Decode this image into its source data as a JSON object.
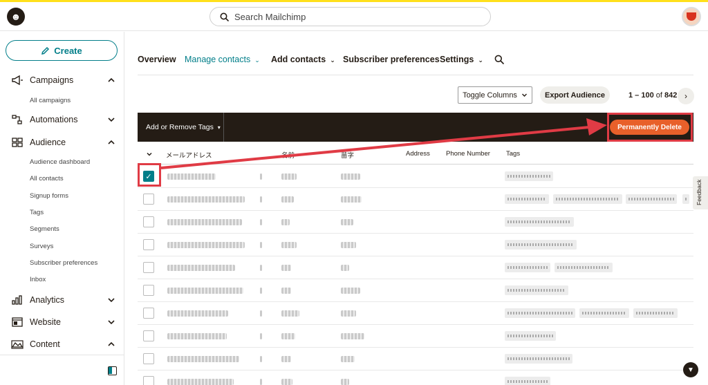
{
  "app": {
    "logo_icon": "mailchimp-logo-icon",
    "accent": "#017e89",
    "brand_yellow": "#ffe01b"
  },
  "search": {
    "placeholder": "Search Mailchimp"
  },
  "sidebar": {
    "create_label": "Create",
    "sections": [
      {
        "label": "Campaigns",
        "icon": "megaphone-icon",
        "expanded": true,
        "items": [
          "All campaigns"
        ]
      },
      {
        "label": "Automations",
        "icon": "automations-icon",
        "expanded": false,
        "items": []
      },
      {
        "label": "Audience",
        "icon": "audience-icon",
        "expanded": true,
        "items": [
          "Audience dashboard",
          "All contacts",
          "Signup forms",
          "Tags",
          "Segments",
          "Surveys",
          "Subscriber preferences",
          "Inbox"
        ]
      },
      {
        "label": "Analytics",
        "icon": "bar-chart-icon",
        "expanded": false,
        "items": []
      },
      {
        "label": "Website",
        "icon": "website-icon",
        "expanded": false,
        "items": []
      },
      {
        "label": "Content",
        "icon": "content-icon",
        "expanded": true,
        "items": []
      }
    ]
  },
  "tabs": [
    {
      "label": "Overview",
      "active": false,
      "dropdown": false
    },
    {
      "label": "Manage contacts",
      "active": true,
      "dropdown": true
    },
    {
      "label": "Add contacts",
      "active": false,
      "dropdown": true
    },
    {
      "label": "Subscriber preferences",
      "active": false,
      "dropdown": false
    },
    {
      "label": "Settings",
      "active": false,
      "dropdown": true
    }
  ],
  "toolbar": {
    "toggle_columns_label": "Toggle Columns",
    "export_label": "Export Audience",
    "pager_range": "1 – 100",
    "pager_of": "of",
    "pager_total": "842"
  },
  "actionbar": {
    "tags_label": "Add or Remove Tags",
    "delete_label": "Permanently Delete",
    "delete_color": "#e8602a",
    "highlight_color": "#e03b45"
  },
  "table": {
    "columns": [
      "メールアドレス",
      "名前",
      "苗字",
      "Address",
      "Phone Number",
      "Tags"
    ],
    "row_count": 10,
    "checked_rows": [
      0
    ]
  },
  "feedback_label": "Feedback"
}
